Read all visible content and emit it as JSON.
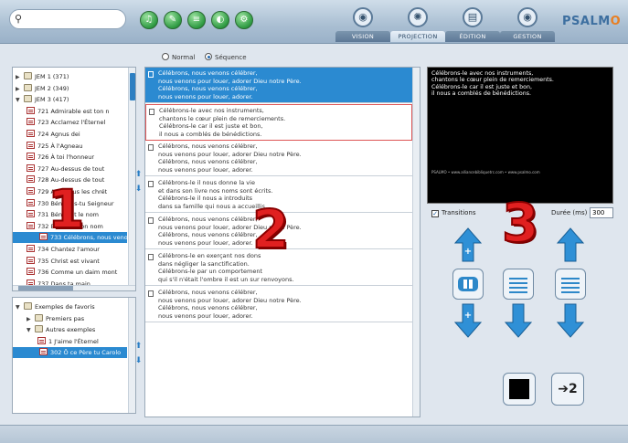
{
  "search": {
    "placeholder": ""
  },
  "toolbar": {
    "buttons": [
      {
        "icon": "music-note-icon",
        "glyph": "♫"
      },
      {
        "icon": "edit-icon",
        "glyph": "✎"
      },
      {
        "icon": "list-icon",
        "glyph": "≡"
      },
      {
        "icon": "globe-icon",
        "glyph": "◐"
      },
      {
        "icon": "settings-icon",
        "glyph": "⚙"
      }
    ]
  },
  "nav": {
    "tabs": [
      {
        "label": "VISION",
        "glyph": "◉",
        "active": false
      },
      {
        "label": "PROJECTION",
        "glyph": "✺",
        "active": true
      },
      {
        "label": "ÉDITION",
        "glyph": "▤",
        "active": false
      },
      {
        "label": "GESTION",
        "glyph": "◉",
        "active": false
      }
    ],
    "logo_main": "PSALM",
    "logo_end": "O"
  },
  "library": {
    "rows": [
      {
        "type": "folder",
        "twisty": "▶",
        "indent": 0,
        "label": "JEM 1 (371)"
      },
      {
        "type": "folder",
        "twisty": "▶",
        "indent": 0,
        "label": "JEM 2 (349)"
      },
      {
        "type": "folder",
        "twisty": "▼",
        "indent": 0,
        "label": "JEM 3 (417)"
      },
      {
        "type": "song",
        "twisty": "",
        "indent": 1,
        "label": "721 Admirable est ton n"
      },
      {
        "type": "song",
        "twisty": "",
        "indent": 1,
        "label": "723 Acclamez l'Éternel"
      },
      {
        "type": "song",
        "twisty": "",
        "indent": 1,
        "label": "724 Agnus dei"
      },
      {
        "type": "song",
        "twisty": "",
        "indent": 1,
        "label": "725 À l'Agneau"
      },
      {
        "type": "song",
        "twisty": "",
        "indent": 1,
        "label": "726 À toi l'honneur"
      },
      {
        "type": "song",
        "twisty": "",
        "indent": 1,
        "label": "727 Au-dessus de tout"
      },
      {
        "type": "song",
        "twisty": "",
        "indent": 1,
        "label": "728 Au-dessus de tout"
      },
      {
        "type": "song",
        "twisty": "",
        "indent": 1,
        "label": "729 Avec tous les chrét"
      },
      {
        "type": "song",
        "twisty": "",
        "indent": 1,
        "label": "730 Béni sois-tu Seigneur"
      },
      {
        "type": "song",
        "twisty": "",
        "indent": 1,
        "label": "731 Béni soit le nom"
      },
      {
        "type": "song",
        "twisty": "",
        "indent": 1,
        "label": "732 Béni soit ton nom"
      },
      {
        "type": "song",
        "twisty": "",
        "indent": 1,
        "label": "733 Célébrons, nous venon",
        "selected": true
      },
      {
        "type": "song",
        "twisty": "",
        "indent": 1,
        "label": "734 Chantez l'amour"
      },
      {
        "type": "song",
        "twisty": "",
        "indent": 1,
        "label": "735 Christ est vivant"
      },
      {
        "type": "song",
        "twisty": "",
        "indent": 1,
        "label": "736 Comme un daim mont"
      },
      {
        "type": "song",
        "twisty": "",
        "indent": 1,
        "label": "737 Dans ta main"
      }
    ]
  },
  "favorites": {
    "rows": [
      {
        "type": "folder",
        "twisty": "▼",
        "indent": 0,
        "label": "Exemples de favoris"
      },
      {
        "type": "folder",
        "twisty": "▶",
        "indent": 1,
        "label": "Premiers pas"
      },
      {
        "type": "folder",
        "twisty": "▼",
        "indent": 1,
        "label": "Autres exemples"
      },
      {
        "type": "song",
        "twisty": "",
        "indent": 2,
        "label": "1 J'aime l'Éternel"
      },
      {
        "type": "song",
        "twisty": "",
        "indent": 0,
        "label": "302 Ô ce Père tu Carolo",
        "selected": true
      }
    ]
  },
  "mode": {
    "normal": "Normal",
    "sequence": "Séquence",
    "selected": "sequence"
  },
  "verses": [
    {
      "lines": [
        "Célébrons, nous venons célébrer,",
        "nous venons pour louer, adorer Dieu notre Père.",
        "Célébrons, nous venons célébrer,",
        "nous venons pour louer, adorer."
      ],
      "state": "selected"
    },
    {
      "lines": [
        "Célébrons-le avec nos instruments,",
        "chantons le cœur plein de remerciements.",
        "Célébrons-le car il est juste et bon,",
        "il nous a comblés de bénédictions."
      ],
      "state": "next"
    },
    {
      "lines": [
        "Célébrons, nous venons célébrer,",
        "nous venons pour louer, adorer Dieu notre Père.",
        "Célébrons, nous venons célébrer,",
        "nous venons pour louer, adorer."
      ],
      "state": ""
    },
    {
      "lines": [
        "Célébrons-le il nous donne la vie",
        "et dans son livre nos noms sont écrits.",
        "Célébrons-le il nous a introduits",
        "dans sa famille qui nous a accueillis."
      ],
      "state": ""
    },
    {
      "lines": [
        "Célébrons, nous venons célébrer,",
        "nous venons pour louer, adorer Dieu notre Père.",
        "Célébrons, nous venons célébrer,",
        "nous venons pour louer, adorer."
      ],
      "state": ""
    },
    {
      "lines": [
        "Célébrons-le en exerçant nos dons",
        "dans négliger la sanctification.",
        "Célébrons-le par un comportement",
        "qui s'il n'était l'ombre il est un sur renvoyons."
      ],
      "state": ""
    },
    {
      "lines": [
        "Célébrons, nous venons célébrer,",
        "nous venons pour louer, adorer Dieu notre Père.",
        "Célébrons, nous venons célébrer,",
        "nous venons pour louer, adorer."
      ],
      "state": ""
    }
  ],
  "preview": {
    "lines": [
      "Célébrons-le avec nos instruments,",
      "chantons le cœur plein de remerciements.",
      "Célébrons-le car il est juste et bon,",
      "il nous a comblés de bénédictions."
    ],
    "footer": "PSALMO • www.alliancebibliquetrc.com • www.psalmo.com"
  },
  "controls": {
    "transitions_label": "Transitions",
    "transitions_checked": true,
    "duration_label": "Durée (ms)",
    "duration_value": "300",
    "screen_button_label": "➔2"
  },
  "overlay_numbers": [
    "1",
    "2",
    "3"
  ],
  "colors": {
    "accent": "#2b8ad1",
    "overlay": "#e02020",
    "logo": "#3d6fa0"
  }
}
